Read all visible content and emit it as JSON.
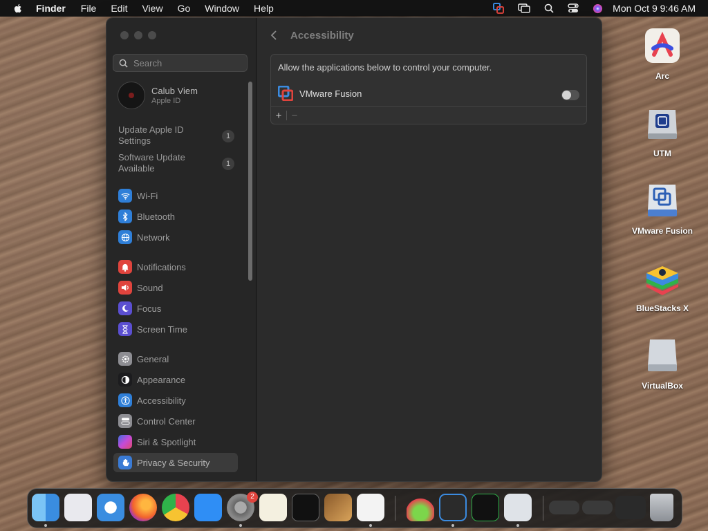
{
  "menubar": {
    "app": "Finder",
    "items": [
      "File",
      "Edit",
      "View",
      "Go",
      "Window",
      "Help"
    ],
    "clock": "Mon Oct 9  9:46 AM"
  },
  "sidebar": {
    "search_placeholder": "Search",
    "account": {
      "name": "Calub Viem",
      "sub": "Apple ID"
    },
    "notices": [
      {
        "label": "Update Apple ID Settings",
        "count": "1"
      },
      {
        "label": "Software Update Available",
        "count": "1"
      }
    ],
    "items": [
      {
        "label": "Wi-Fi",
        "color": "#2f7fd8"
      },
      {
        "label": "Bluetooth",
        "color": "#2f7fd8"
      },
      {
        "label": "Network",
        "color": "#2f7fd8"
      },
      {
        "label": "Notifications",
        "color": "#e0443d"
      },
      {
        "label": "Sound",
        "color": "#e0443d"
      },
      {
        "label": "Focus",
        "color": "#5b4fd1"
      },
      {
        "label": "Screen Time",
        "color": "#5b4fd1"
      },
      {
        "label": "General",
        "color": "#8e8e93"
      },
      {
        "label": "Appearance",
        "color": "#1c1c1e"
      },
      {
        "label": "Accessibility",
        "color": "#2f7fd8"
      },
      {
        "label": "Control Center",
        "color": "#8e8e93"
      },
      {
        "label": "Siri & Spotlight",
        "color": "#c44bd8"
      },
      {
        "label": "Privacy & Security",
        "color": "#3a7bd5",
        "selected": true
      }
    ]
  },
  "content": {
    "title": "Accessibility",
    "description": "Allow the applications below to control your computer.",
    "apps": [
      {
        "name": "VMware Fusion",
        "enabled": false
      }
    ],
    "add_label": "+",
    "remove_label": "−"
  },
  "desktop": {
    "icons": [
      "Arc",
      "UTM",
      "VMware Fusion",
      "BlueStacks X",
      "VirtualBox"
    ]
  },
  "dock": {
    "settings_badge": "2"
  }
}
